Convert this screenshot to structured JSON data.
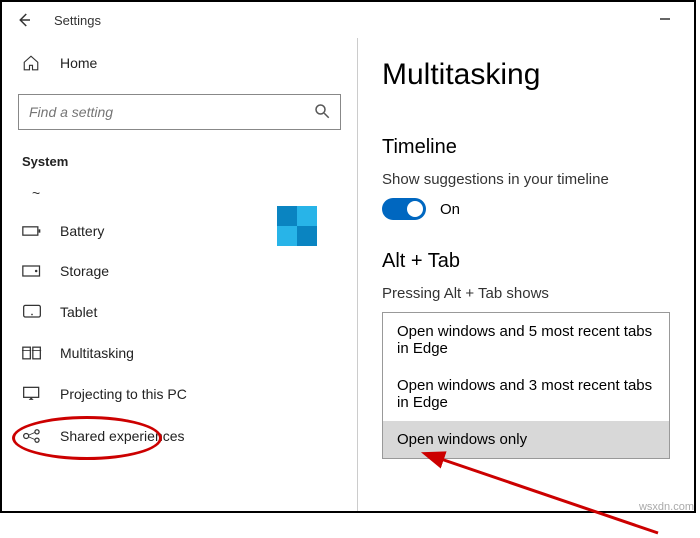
{
  "window": {
    "title": "Settings"
  },
  "sidebar": {
    "home": "Home",
    "search_placeholder": "Find a setting",
    "section": "System",
    "truncated": "~",
    "items": [
      {
        "label": "Battery"
      },
      {
        "label": "Storage"
      },
      {
        "label": "Tablet"
      },
      {
        "label": "Multitasking"
      },
      {
        "label": "Projecting to this PC"
      },
      {
        "label": "Shared experiences"
      }
    ]
  },
  "main": {
    "title": "Multitasking",
    "timeline": {
      "heading": "Timeline",
      "desc": "Show suggestions in your timeline",
      "toggle_label": "On"
    },
    "alttab": {
      "heading": "Alt + Tab",
      "desc": "Pressing Alt + Tab shows",
      "options": [
        "Open windows and 5 most recent tabs in Edge",
        "Open windows and 3 most recent tabs in Edge",
        "Open windows only"
      ]
    }
  },
  "watermark": "wsxdn.com"
}
